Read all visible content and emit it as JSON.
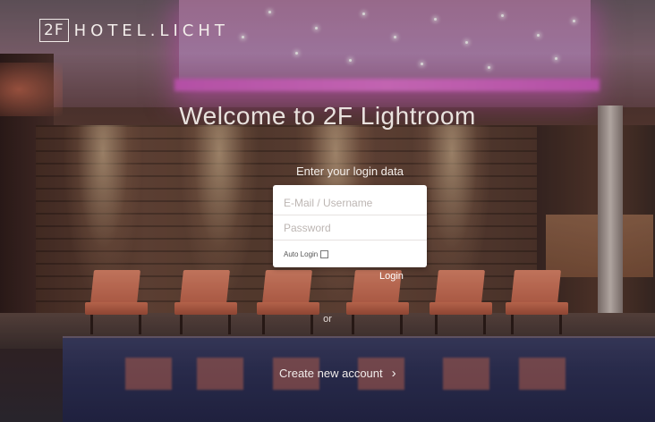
{
  "brand": {
    "mark": "2F",
    "name": "HOTEL.LICHT"
  },
  "hero": {
    "title": "Welcome to 2F Lightroom"
  },
  "login_form": {
    "heading": "Enter your login data",
    "username_placeholder": "E-Mail / Username",
    "password_placeholder": "Password",
    "auto_login_label": "Auto Login",
    "submit_label": "Login"
  },
  "divider_text": "or",
  "create_account": {
    "label": "Create new account",
    "icon": "chevron-right-icon"
  }
}
